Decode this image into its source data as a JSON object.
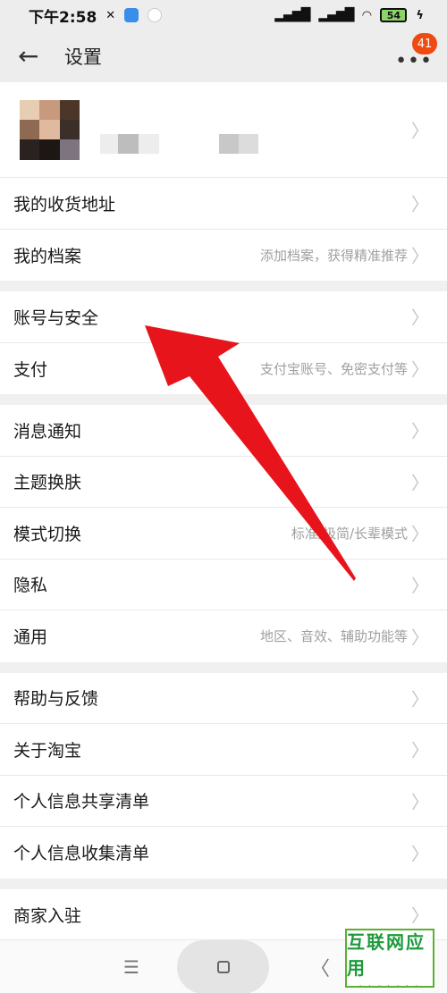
{
  "status_bar": {
    "time": "下午2:58",
    "battery": "54"
  },
  "header": {
    "back_icon": "arrow-left-icon",
    "title": "设置",
    "more_icon": "more-dots-icon",
    "badge_count": "41"
  },
  "profile": {
    "avatar_colors": [
      "#e7cdb3",
      "#c79a7d",
      "#4b3628",
      "#8f6a52",
      "#e1b99e",
      "#3b2f2a",
      "#2a2220",
      "#1c1714",
      "#7d7480"
    ]
  },
  "groups": [
    {
      "rows": [
        {
          "label": "我的收货地址",
          "value": ""
        },
        {
          "label": "我的档案",
          "value": "添加档案，获得精准推荐"
        }
      ]
    },
    {
      "rows": [
        {
          "label": "账号与安全",
          "value": ""
        },
        {
          "label": "支付",
          "value": "支付宝账号、免密支付等"
        }
      ]
    },
    {
      "rows": [
        {
          "label": "消息通知",
          "value": ""
        },
        {
          "label": "主题换肤",
          "value": ""
        },
        {
          "label": "模式切换",
          "value": "标准/极简/长辈模式"
        },
        {
          "label": "隐私",
          "value": ""
        },
        {
          "label": "通用",
          "value": "地区、音效、辅助功能等"
        }
      ]
    },
    {
      "rows": [
        {
          "label": "帮助与反馈",
          "value": ""
        },
        {
          "label": "关于淘宝",
          "value": ""
        },
        {
          "label": "个人信息共享清单",
          "value": ""
        },
        {
          "label": "个人信息收集清单",
          "value": ""
        }
      ]
    },
    {
      "rows": [
        {
          "label": "商家入驻",
          "value": ""
        }
      ]
    }
  ],
  "nav_bar": {
    "menu_icon": "menu-icon",
    "home_icon": "home-square-icon",
    "back_icon": "chevron-left-icon"
  },
  "watermark": {
    "text": "互联网应用"
  },
  "colors": {
    "accent": "#f04a13",
    "annotation_arrow": "#e8141c"
  }
}
